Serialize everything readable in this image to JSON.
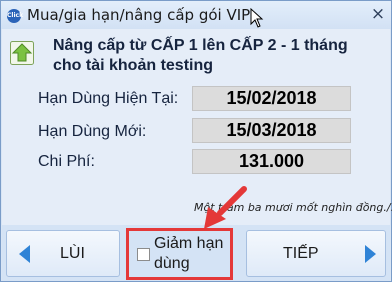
{
  "window": {
    "title": "Mua/gia hạn/nâng cấp gói VIP",
    "app_icon_text": "Click",
    "close_glyph": "×"
  },
  "header": {
    "icon": "upgrade-arrow-icon",
    "line1": "Nâng cấp từ CẤP 1 lên CẤP 2 - 1 tháng",
    "line2": "cho tài khoản testing"
  },
  "details": {
    "current_expiry_label": "Hạn Dùng Hiện Tại:",
    "current_expiry_value": "15/02/2018",
    "new_expiry_label": "Hạn Dùng Mới:",
    "new_expiry_value": "15/03/2018",
    "cost_label": "Chi Phí:",
    "cost_value": "131.000",
    "amount_in_words": "Một trăm ba mươi mốt nghìn đồng./."
  },
  "footer": {
    "back_label": "LÙI",
    "reduce_term_label": "Giảm hạn dùng",
    "reduce_term_checked": false,
    "next_label": "TIẾP"
  },
  "colors": {
    "window_bg": "#d8e5f5",
    "value_box_bg": "#dcdcdc",
    "nav_arrow": "#2f83d6",
    "annotation": "#e43838"
  }
}
